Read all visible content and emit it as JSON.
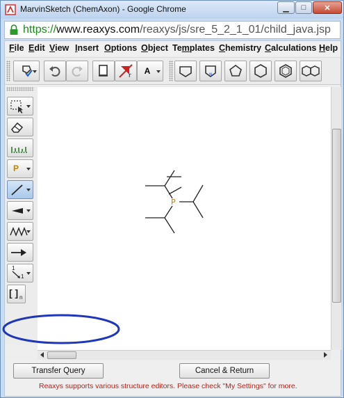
{
  "window": {
    "title": "MarvinSketch (ChemAxon) - Google Chrome",
    "min_label": "▁",
    "max_label": "□",
    "close_label": "✕"
  },
  "address": {
    "scheme": "https://",
    "host": "www.reaxys.com",
    "path": "/reaxys/js/sre_5_2_1_01/child_java.jsp"
  },
  "menu": [
    "File",
    "Edit",
    "View",
    "Insert",
    "Options",
    "Object",
    "Templates",
    "Chemistry",
    "Calculations",
    "Help"
  ],
  "menu_mnemonics": [
    "F",
    "E",
    "V",
    "I",
    "O",
    "O",
    "m",
    "C",
    "C",
    "H"
  ],
  "toolbar": {
    "font_label": "A"
  },
  "left_tools": {
    "atom_label": "P",
    "bracket_label": "[ ]",
    "bracket_sub": "n",
    "number_label": "1",
    "number_sub": "1"
  },
  "molecule": {
    "phosphorus_label": "P",
    "atom_color": "#b8860b"
  },
  "buttons": {
    "transfer": "Transfer Query",
    "cancel": "Cancel & Return"
  },
  "notice": "Reaxys supports various structure editors. Please check \"My Settings\" for more.",
  "colors": {
    "notice": "#b1241b",
    "annotation": "#1f36b8",
    "url_scheme": "#1a8a1a"
  }
}
